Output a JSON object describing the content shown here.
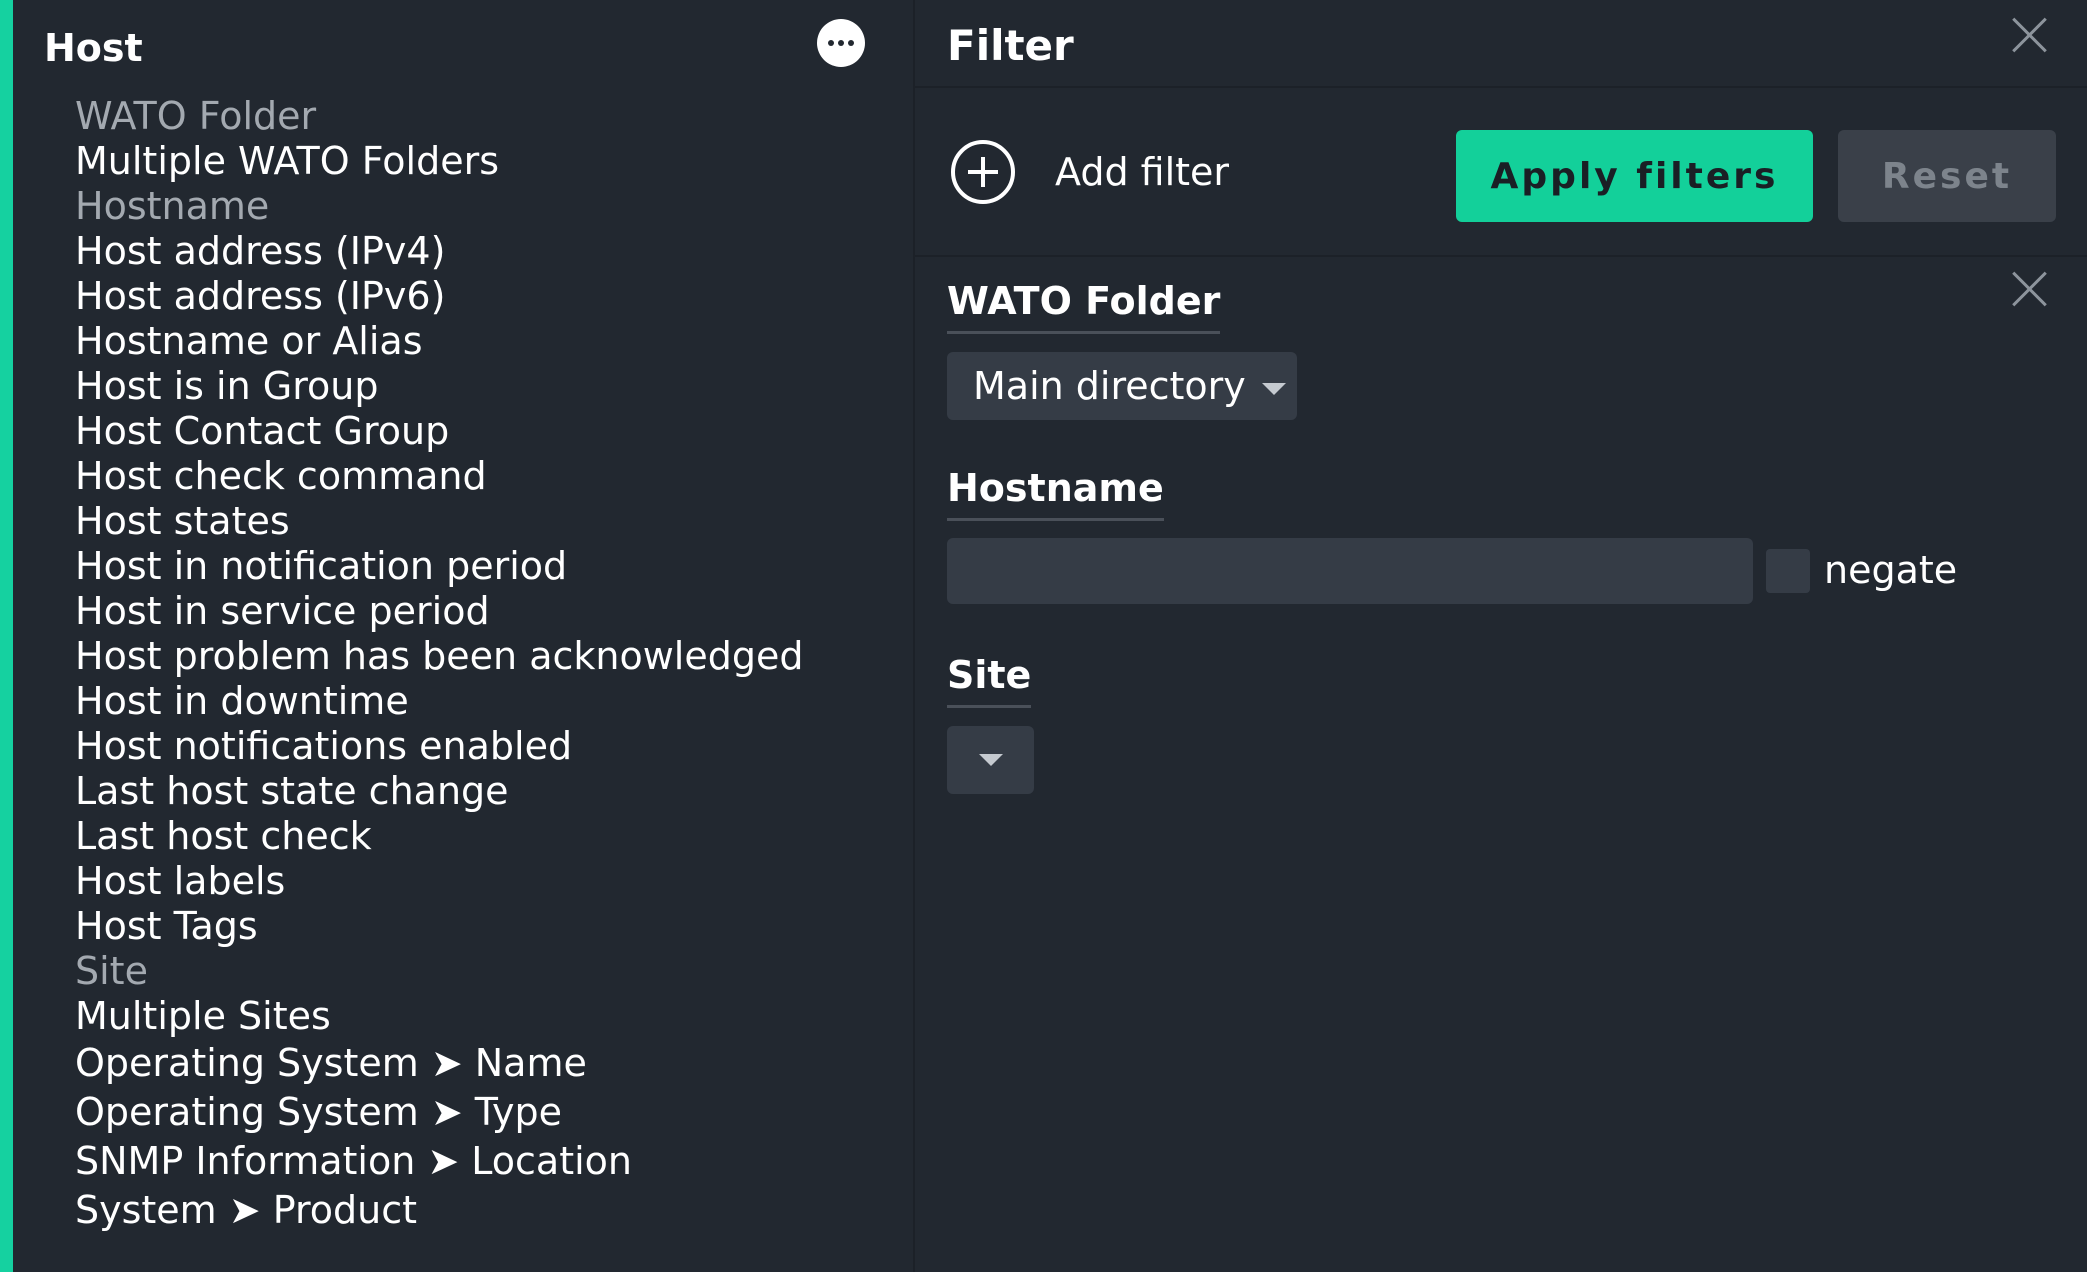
{
  "left_panel": {
    "title": "Host",
    "more_icon": "more-horizontal-icon",
    "items": [
      {
        "label": "WATO Folder",
        "used": true
      },
      {
        "label": "Multiple WATO Folders",
        "used": false
      },
      {
        "label": "Hostname",
        "used": true
      },
      {
        "label": "Host address (IPv4)",
        "used": false
      },
      {
        "label": "Host address (IPv6)",
        "used": false
      },
      {
        "label": "Hostname or Alias",
        "used": false
      },
      {
        "label": "Host is in Group",
        "used": false
      },
      {
        "label": "Host Contact Group",
        "used": false
      },
      {
        "label": "Host check command",
        "used": false
      },
      {
        "label": "Host states",
        "used": false
      },
      {
        "label": "Host in notification period",
        "used": false
      },
      {
        "label": "Host in service period",
        "used": false
      },
      {
        "label": "Host problem has been acknowledged",
        "used": false
      },
      {
        "label": "Host in downtime",
        "used": false
      },
      {
        "label": "Host notifications enabled",
        "used": false
      },
      {
        "label": "Last host state change",
        "used": false
      },
      {
        "label": "Last host check",
        "used": false
      },
      {
        "label": "Host labels",
        "used": false
      },
      {
        "label": "Host Tags",
        "used": false
      },
      {
        "label": "Site",
        "used": true
      },
      {
        "label": "Multiple Sites",
        "used": false
      },
      {
        "label": "Operating System ➤ Name",
        "used": false
      },
      {
        "label": "Operating System ➤ Type",
        "used": false
      },
      {
        "label": "SNMP Information ➤ Location",
        "used": false
      },
      {
        "label": "System ➤ Product",
        "used": false
      }
    ]
  },
  "right_panel": {
    "title": "Filter",
    "add_filter_label": "Add filter",
    "apply_label": "Apply filters",
    "reset_label": "Reset",
    "filters": {
      "wato_folder": {
        "label": "WATO Folder",
        "selected": "Main directory"
      },
      "hostname": {
        "label": "Hostname",
        "value": "",
        "negate_label": "negate",
        "negate_checked": false
      },
      "site": {
        "label": "Site",
        "selected": ""
      }
    }
  },
  "colors": {
    "accent": "#15d1a0",
    "apply_button": "#13d09a",
    "background": "#222830",
    "input_bg": "#353c46",
    "used_item_text": "#a3a9b0"
  }
}
